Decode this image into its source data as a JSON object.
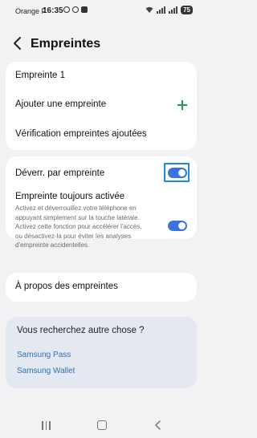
{
  "status_bar": {
    "carrier": "Orange F",
    "time": "16:35",
    "battery": "75"
  },
  "header": {
    "title": "Empreintes",
    "back_icon": "back-arrow-icon"
  },
  "fingerprints_card": {
    "fingerprint_1": "Empreinte 1",
    "add_fingerprint": "Ajouter une empreinte",
    "add_icon": "plus-icon",
    "add_icon_color": "#1d9a55",
    "check_fingerprints": "Vérification empreintes ajoutées"
  },
  "options_card": {
    "unlock_label": "Déverr. par empreinte",
    "unlock_on": true,
    "always_on_label": "Empreinte toujours activée",
    "always_on_desc": "Activez et déverrouillez votre téléphone en appuyant simplement sur la touche latérale. Activez cette fonction pour accélérer l'accès, ou désactivez-la pour éviter les analyses d'empreinte accidentelles.",
    "always_on_on": true,
    "toggle_color": "#3a73e0"
  },
  "about_card": {
    "about_label": "À propos des empreintes"
  },
  "suggestions": {
    "title": "Vous recherchez autre chose ?",
    "links": [
      "Samsung Pass",
      "Samsung Wallet"
    ],
    "link_color": "#2f6fb8"
  },
  "navbar": {
    "recents_icon": "recents-icon",
    "home_icon": "home-icon",
    "back_icon": "nav-back-icon"
  }
}
